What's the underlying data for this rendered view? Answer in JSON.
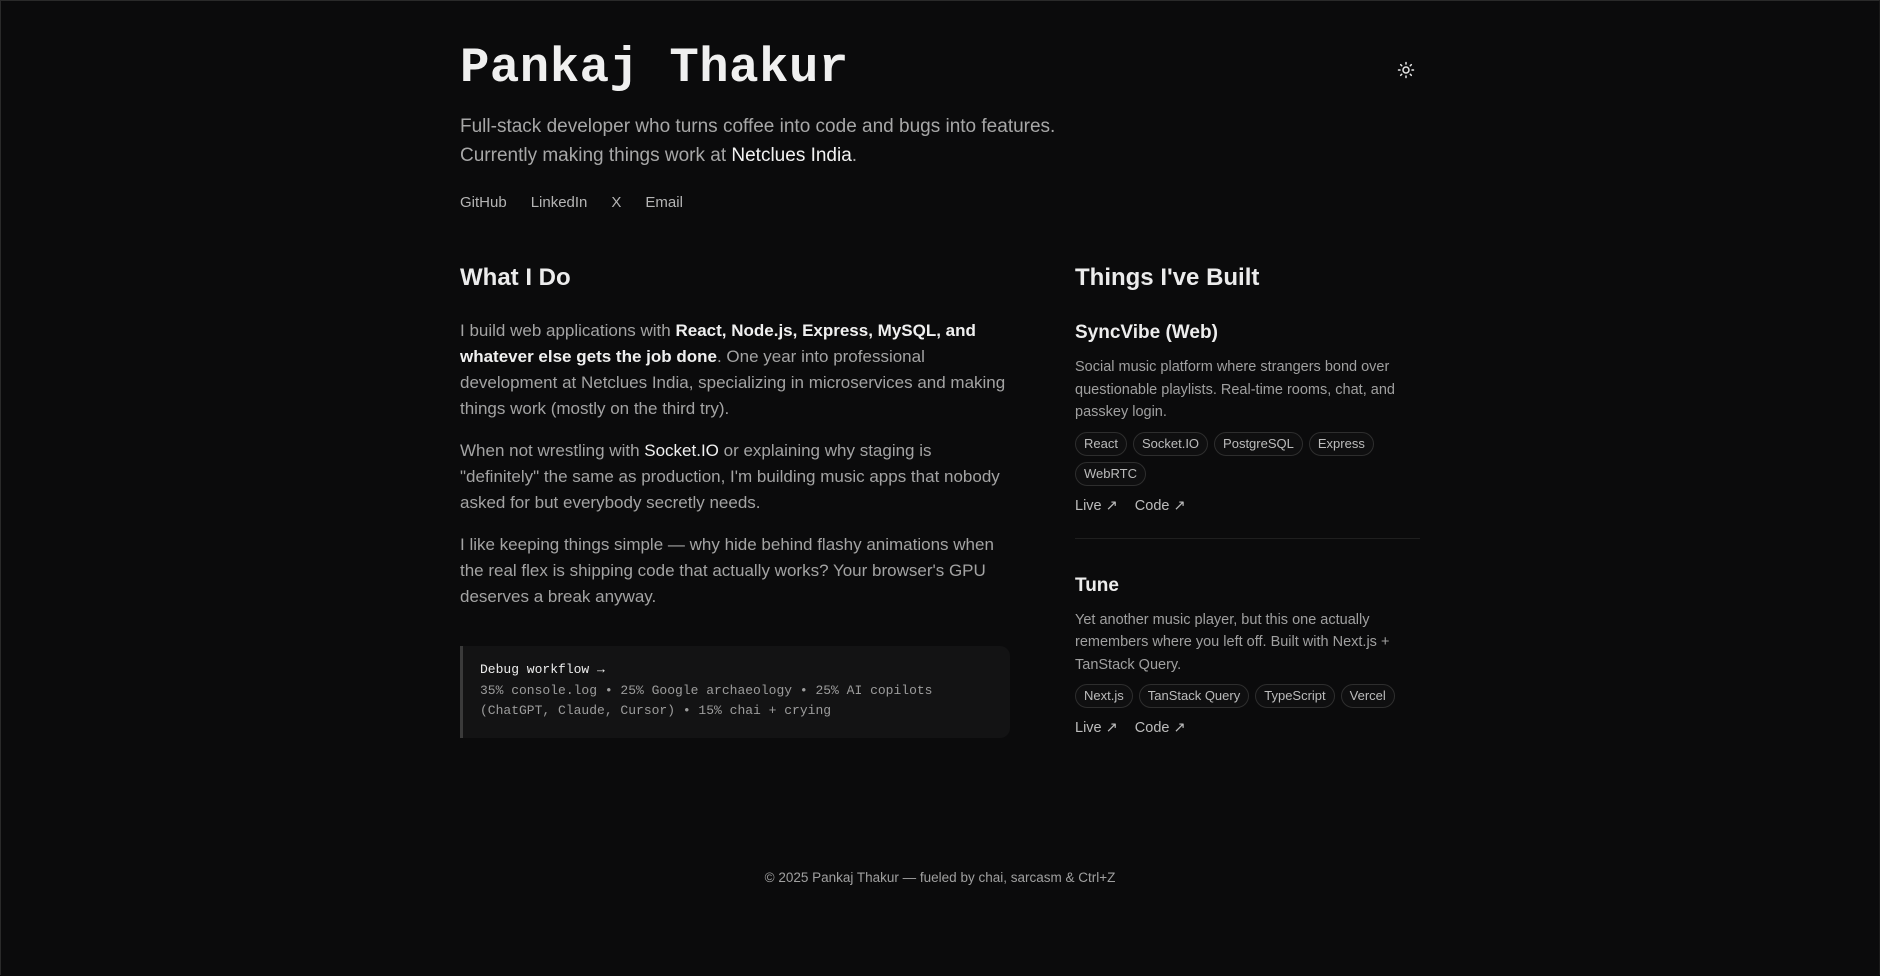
{
  "header": {
    "name": "Pankaj Thakur",
    "intro_line1": "Full-stack developer who turns coffee into code and bugs into features.",
    "intro_line2_prefix": "Currently making things work at ",
    "intro_company": "Netclues India",
    "intro_line2_suffix": ".",
    "theme_toggle_icon": "sun-icon"
  },
  "social": [
    {
      "label": "GitHub"
    },
    {
      "label": "LinkedIn"
    },
    {
      "label": "X"
    },
    {
      "label": "Email"
    }
  ],
  "about": {
    "heading": "What I Do",
    "p1_prefix": "I build web applications with ",
    "p1_strong": "React, Node.js, Express, MySQL, and whatever else gets the job done",
    "p1_suffix": ". One year into professional development at Netclues India, specializing in microservices and making things work (mostly on the third try).",
    "p2_prefix": "When not wrestling with ",
    "p2_highlight": "Socket.IO",
    "p2_suffix": " or explaining why staging is \"definitely\" the same as production, I'm building music apps that nobody asked for but everybody secretly needs.",
    "p3": "I like keeping things simple — why hide behind flashy animations when the real flex is shipping code that actually works? Your browser's GPU deserves a break anyway.",
    "code_title": "Debug workflow →",
    "code_line1": "35% console.log • 25% Google archaeology • 25% AI copilots",
    "code_line2": "(ChatGPT, Claude, Cursor) • 15% chai + crying"
  },
  "projects": {
    "heading": "Things I've Built",
    "items": [
      {
        "name": "SyncVibe (Web)",
        "description": "Social music platform where strangers bond over questionable playlists. Real-time rooms, chat, and passkey login.",
        "tags": [
          "React",
          "Socket.IO",
          "PostgreSQL",
          "Express",
          "WebRTC"
        ],
        "live_label": "Live ↗",
        "code_label": "Code ↗"
      },
      {
        "name": "Tune",
        "description": "Yet another music player, but this one actually remembers where you left off. Built with Next.js + TanStack Query.",
        "tags": [
          "Next.js",
          "TanStack Query",
          "TypeScript",
          "Vercel"
        ],
        "live_label": "Live ↗",
        "code_label": "Code ↗"
      }
    ]
  },
  "footer": {
    "text": "© 2025 Pankaj Thakur — fueled by chai, sarcasm & Ctrl+Z"
  }
}
